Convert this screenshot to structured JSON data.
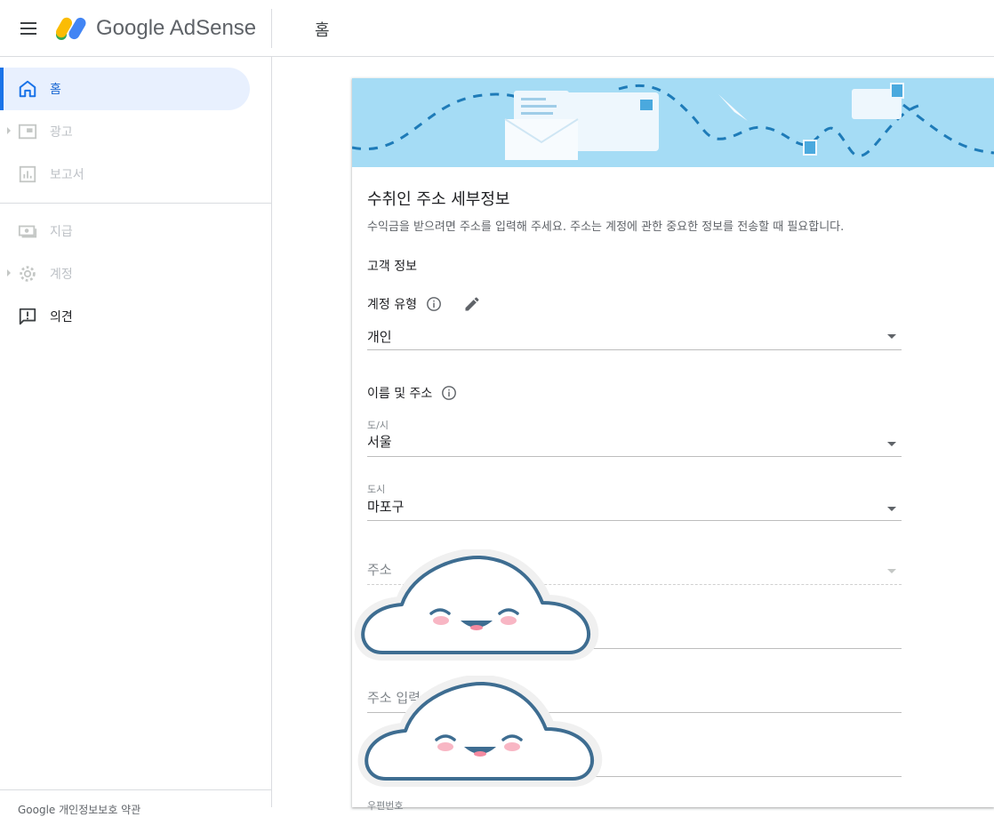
{
  "app": {
    "brand": "Google AdSense",
    "page_title": "홈"
  },
  "sidebar": {
    "items": [
      {
        "label": "홈",
        "state": "active",
        "icon": "home-icon"
      },
      {
        "label": "광고",
        "state": "disabled",
        "icon": "ads-icon"
      },
      {
        "label": "보고서",
        "state": "disabled",
        "icon": "reports-icon"
      },
      {
        "label": "지급",
        "state": "disabled",
        "icon": "payments-icon"
      },
      {
        "label": "계정",
        "state": "disabled",
        "icon": "gear-icon"
      },
      {
        "label": "의견",
        "state": "normal",
        "icon": "feedback-icon"
      }
    ],
    "footer": "Google 개인정보보호 약관"
  },
  "form": {
    "title": "수취인 주소 세부정보",
    "description": "수익금을 받으려면 주소를 입력해 주세요. 주소는 계정에 관한 중요한 정보를 전송할 때 필요합니다.",
    "section": "고객 정보",
    "account_type": {
      "label": "계정 유형",
      "value": "개인"
    },
    "name_address_label": "이름 및 주소",
    "province": {
      "label": "도/시",
      "value": "서울"
    },
    "city": {
      "label": "도시",
      "value": "마포구"
    },
    "address_select": {
      "placeholder": "주소"
    },
    "address_input": {
      "placeholder": "주소 입력"
    },
    "postal_code": {
      "label": "우편번호"
    }
  },
  "colors": {
    "accent": "#1a73e8",
    "active_bg": "#e8f0fe",
    "banner": "#a5dcf5",
    "cloud_outline": "#3e6d91"
  }
}
